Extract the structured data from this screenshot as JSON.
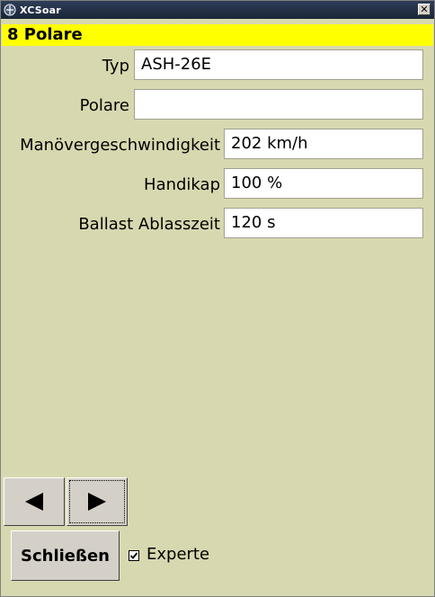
{
  "window": {
    "title": "XCSoar",
    "close_glyph": "✕"
  },
  "dialog": {
    "caption": "8 Polare"
  },
  "form": {
    "rows": [
      {
        "label": "Typ",
        "value": "ASH-26E"
      },
      {
        "label": "Polare",
        "value": ""
      },
      {
        "label": "Manövergeschwindigkeit",
        "value": "202 km/h"
      },
      {
        "label": "Handikap",
        "value": "100 %"
      },
      {
        "label": "Ballast Ablasszeit",
        "value": "120 s"
      }
    ]
  },
  "footer": {
    "prev_icon": "left-triangle-icon",
    "next_icon": "right-triangle-icon",
    "close_label": "Schließen",
    "expert_label": "Experte",
    "expert_checked": true
  }
}
